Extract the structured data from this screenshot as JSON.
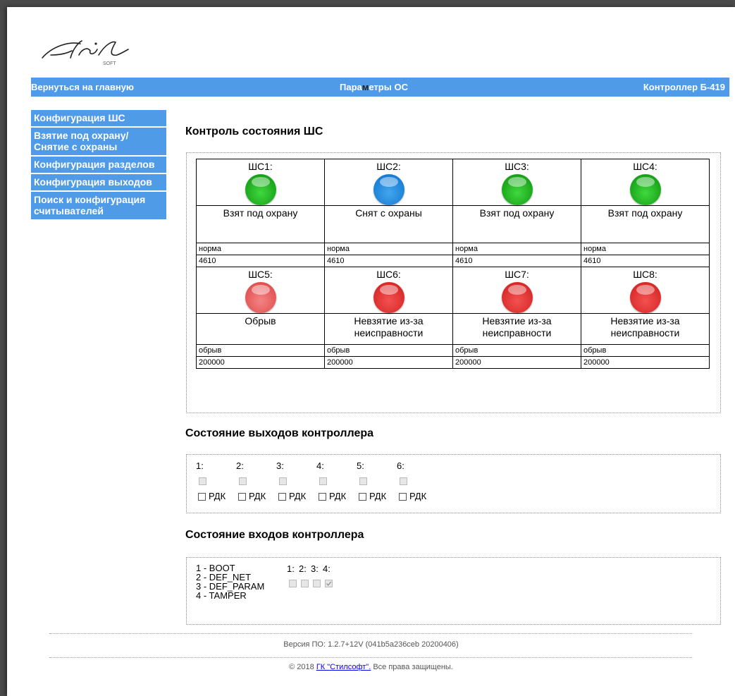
{
  "logo": {
    "text": "Stil",
    "sub": "SOFT"
  },
  "topbar": {
    "back": "Вернуться на главную",
    "title_pre": "Пара",
    "title_hl": "м",
    "title_post": "етры ОС",
    "controller": "Контроллер Б-419"
  },
  "menu": [
    "Конфигурация ШС",
    "Взятие под охрану/ Снятие с охраны",
    "Конфигурация разделов",
    "Конфигурация выходов",
    "Поиск и конфигурация считывателей"
  ],
  "shs_section": {
    "title": "Контроль состояния ШС",
    "loops": [
      {
        "name": "ШС1:",
        "color": "#1fb31f",
        "state": "Взят под охрану",
        "status": "норма",
        "value": "4610"
      },
      {
        "name": "ШС2:",
        "color": "#1b7fd6",
        "state": "Снят с охраны",
        "status": "норма",
        "value": "4610"
      },
      {
        "name": "ШС3:",
        "color": "#1fb31f",
        "state": "Взят под охрану",
        "status": "норма",
        "value": "4610"
      },
      {
        "name": "ШС4:",
        "color": "#1fb31f",
        "state": "Взят под охрану",
        "status": "норма",
        "value": "4610"
      },
      {
        "name": "ШС5:",
        "color": "#e25454",
        "state": "Обрыв",
        "status": "обрыв",
        "value": "200000"
      },
      {
        "name": "ШС6:",
        "color": "#d92b2b",
        "state": "Невзятие из-за неисправности",
        "status": "обрыв",
        "value": "200000"
      },
      {
        "name": "ШС7:",
        "color": "#d92b2b",
        "state": "Невзятие из-за неисправности",
        "status": "обрыв",
        "value": "200000"
      },
      {
        "name": "ШС8:",
        "color": "#d92b2b",
        "state": "Невзятие из-за неисправности",
        "status": "обрыв",
        "value": "200000"
      }
    ]
  },
  "outputs": {
    "title": "Состояние выходов контроллера",
    "labels": [
      "1:",
      "2:",
      "3:",
      "4:",
      "5:",
      "6:"
    ],
    "rdk": "РДК"
  },
  "inputs": {
    "title": "Состояние входов контроллера",
    "legend": [
      "1 - BOOT",
      "2 - DEF_NET",
      "3 - DEF_PARAM",
      "4 - TAMPER"
    ],
    "labels": [
      "1:",
      "2:",
      "3:",
      "4:"
    ],
    "checked": [
      false,
      false,
      false,
      true
    ]
  },
  "footer": {
    "version": "Версия ПО: 1.2.7+12V (041b5a236ceb 20200406)",
    "copyright_pre": "© 2018 ",
    "link": "ГК \"Стилсофт\".",
    "copyright_post": " Все права защищены."
  }
}
